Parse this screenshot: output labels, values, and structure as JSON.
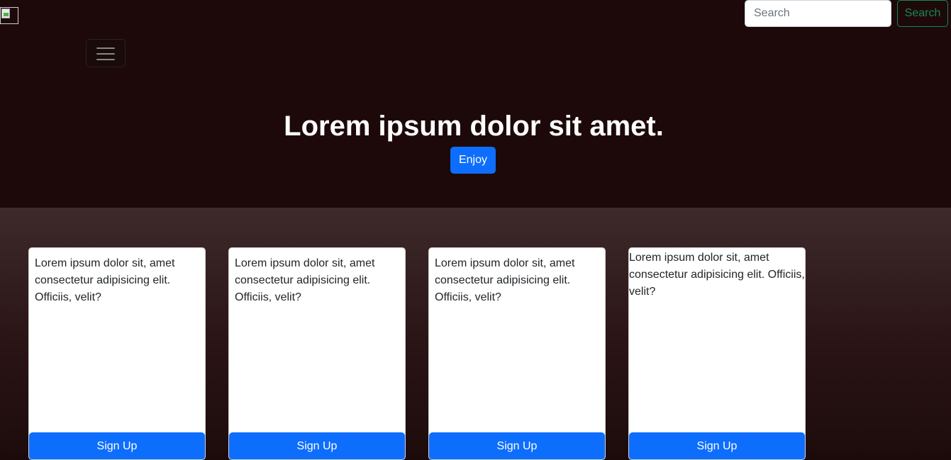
{
  "header": {
    "search": {
      "placeholder": "Search",
      "value": ""
    },
    "search_button_label": "Search",
    "menu_icon": "hamburger-menu-icon"
  },
  "hero": {
    "title": "Lorem ipsum dolor sit amet.",
    "button_label": "Enjoy"
  },
  "cards": [
    {
      "text": "Lorem ipsum dolor sit, amet consectetur adipisicing elit. Officiis, velit?",
      "button_label": "Sign Up"
    },
    {
      "text": "Lorem ipsum dolor sit, amet consectetur adipisicing elit. Officiis, velit?",
      "button_label": "Sign Up"
    },
    {
      "text": "Lorem ipsum dolor sit, amet consectetur adipisicing elit. Officiis, velit?",
      "button_label": "Sign Up"
    },
    {
      "text": "Lorem ipsum dolor sit, amet consectetur adipisicing elit. Officiis, velit?",
      "button_label": "Sign Up"
    }
  ],
  "colors": {
    "hero_background": "#1d0909",
    "primary": "#0d6efd",
    "success": "#198754"
  }
}
